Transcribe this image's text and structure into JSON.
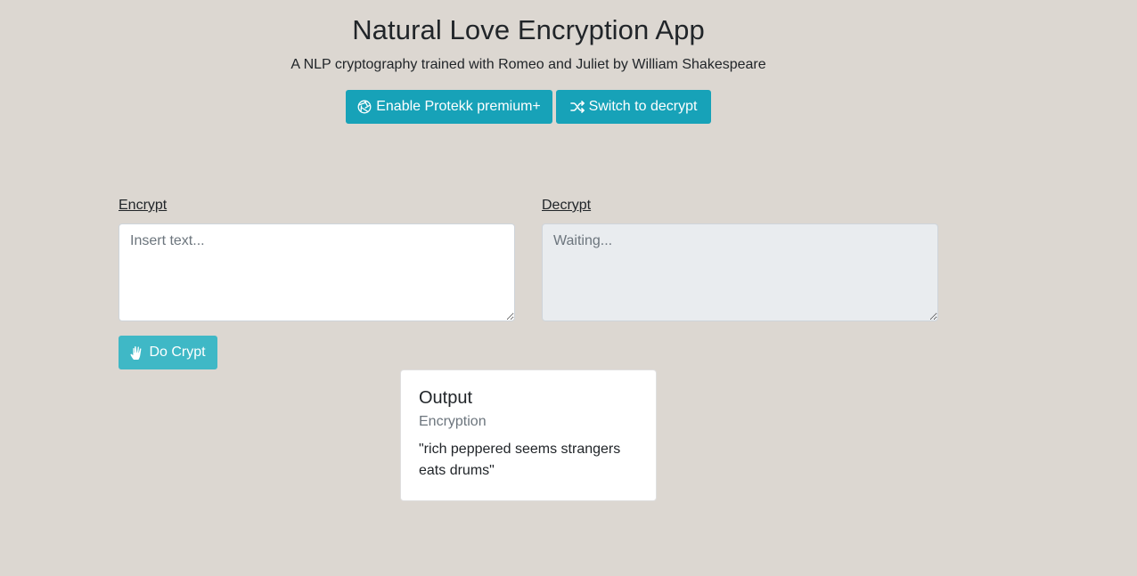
{
  "header": {
    "title": "Natural Love Encryption App",
    "subtitle": "A NLP cryptography trained with Romeo and Juliet by William Shakespeare"
  },
  "toolbar": {
    "premium_label": "Enable Protekk premium+",
    "premium_icon": "aperture-icon",
    "switch_label": "Switch to decrypt",
    "switch_icon": "shuffle-icon"
  },
  "encrypt": {
    "label": "Encrypt",
    "placeholder": "Insert text...",
    "value": ""
  },
  "decrypt": {
    "label": "Decrypt",
    "placeholder": "Waiting...",
    "value": ""
  },
  "action": {
    "crypt_label": "Do Crypt",
    "crypt_icon": "hand-spock-icon"
  },
  "output": {
    "title": "Output",
    "subtitle": "Encryption",
    "text": "\"rich peppered seems strangers eats drums\""
  },
  "colors": {
    "background": "#dcd7d1",
    "accent": "#17a2b8",
    "accent_muted": "#3fb8c6"
  }
}
